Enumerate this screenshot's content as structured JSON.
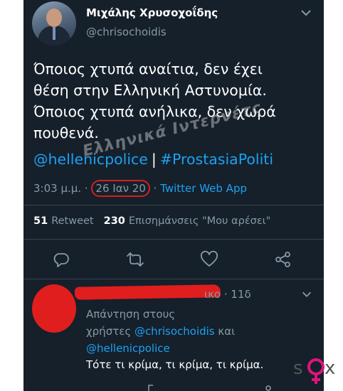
{
  "profile": {
    "name": "Μιχάλης Χρυσοχοΐδης",
    "handle": "@chrisochoidis"
  },
  "tweet": {
    "lines": [
      "Όποιος χτυπά αναίτια, δεν έχει",
      "θέση στην Ελληνική Αστυνομία.",
      "Όποιος χτυπά ανήλικα, δεν χωρά",
      "πουθενά."
    ],
    "mention": "@hellenicpolice",
    "separator": "|",
    "hashtag": "#ProstasiaPoliti",
    "time": "3:03 μ.μ.",
    "dot1": "·",
    "date": "26 Ιαν 20",
    "dot2": "·",
    "app": "Twitter Web App"
  },
  "stats": {
    "retweets_count": "51",
    "retweets_label": "Retweet",
    "likes_count": "230",
    "likes_label": "Επισημάνσεις \"Μου αρέσει\""
  },
  "watermark": "Ελληνικά Ιντερνέτς",
  "reply": {
    "meta": "ικο · 11δ",
    "replying_to": "Απάντηση στους",
    "users_label": "χρήστες",
    "mention1": "@chrisochoidis",
    "and_label": "και",
    "mention2": "@hellenicpolice",
    "text": "Τότε τι κρίμα, τι κρίμα, τι κρίμα."
  },
  "logo": {
    "text1": "s",
    "text2": "x"
  },
  "colors": {
    "background": "#15202b",
    "accent": "#1da1f2",
    "muted": "#8899a6",
    "annotation": "#e01e1e"
  },
  "icons": [
    "chevron-down-icon",
    "reply-icon",
    "retweet-icon",
    "like-icon",
    "share-icon"
  ]
}
